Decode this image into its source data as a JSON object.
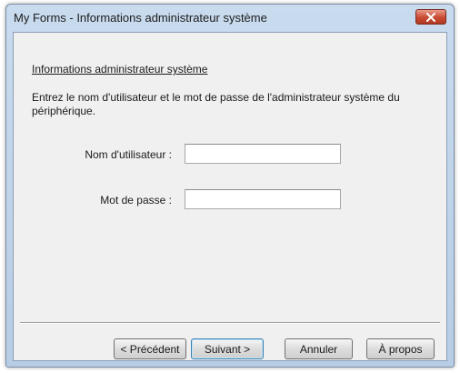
{
  "window": {
    "title": "My Forms - Informations administrateur système"
  },
  "content": {
    "heading": "Informations administrateur système",
    "instruction": "Entrez le nom d'utilisateur et le mot de passe de l'administrateur système du périphérique.",
    "username": {
      "label": "Nom d'utilisateur :",
      "value": ""
    },
    "password": {
      "label": "Mot de passe :",
      "value": ""
    }
  },
  "buttons": {
    "back": "< Précédent",
    "next": "Suivant >",
    "cancel": "Annuler",
    "about": "À propos"
  },
  "icons": {
    "close": "close-icon"
  },
  "colors": {
    "titlebar": "#b7cde6",
    "close_button": "#c94a32",
    "client": "#f0f0f0"
  }
}
